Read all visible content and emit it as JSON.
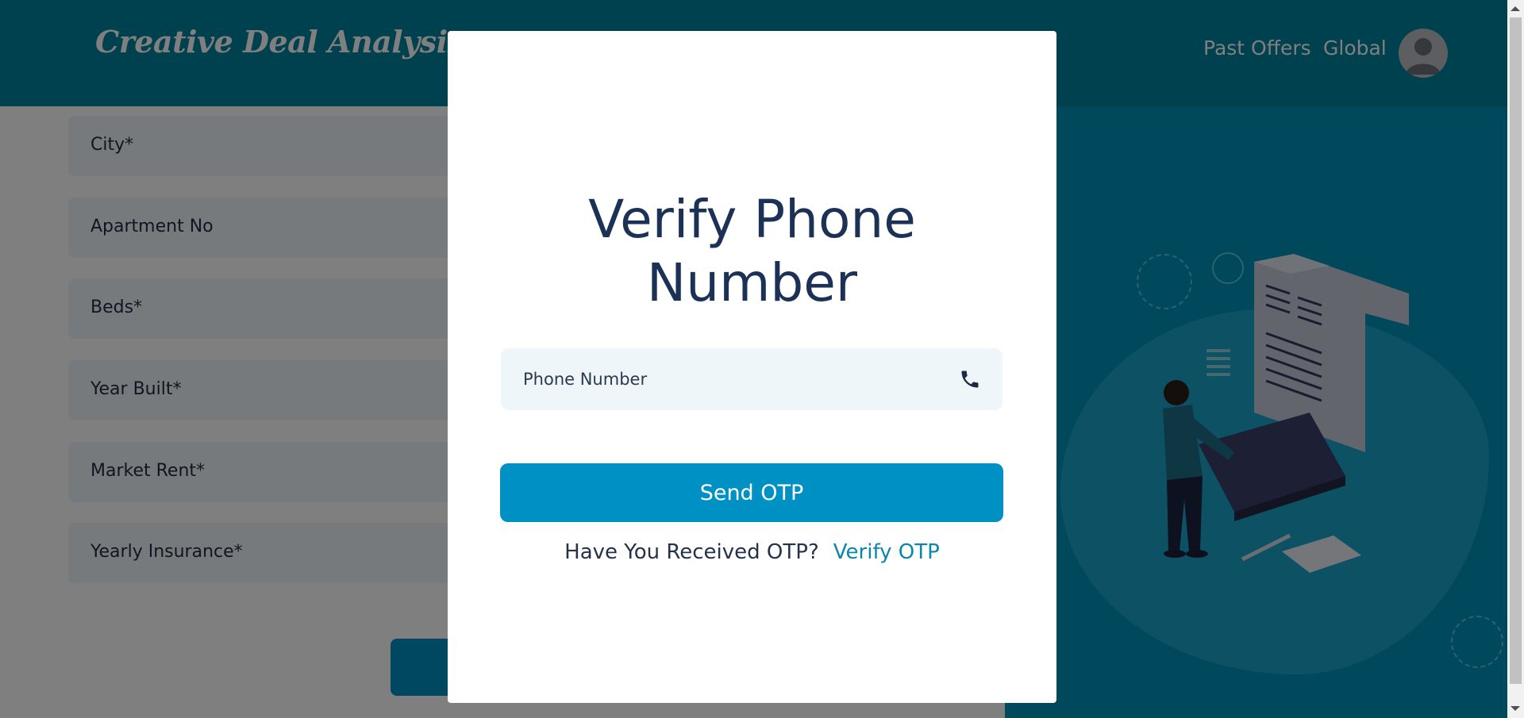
{
  "header": {
    "logo": "Creative Deal Analysis",
    "nav": {
      "past_offers": "Past Offers",
      "global": "Global"
    }
  },
  "form": {
    "fields": [
      "City*",
      "Apartment No",
      "Beds*",
      "Year Built*",
      "Market Rent*",
      "Yearly Insurance*"
    ]
  },
  "modal": {
    "title_line1": "Verify Phone",
    "title_line2": "Number",
    "phone_placeholder": "Phone Number",
    "send_button": "Send OTP",
    "received_text": "Have You Received OTP?",
    "verify_link": "Verify OTP"
  },
  "icons": {
    "phone": "phone-icon",
    "avatar": "user-avatar-icon"
  },
  "colors": {
    "brand": "#00829e",
    "accent": "#0091c4",
    "title": "#1c3156",
    "link": "#0b86ad"
  }
}
